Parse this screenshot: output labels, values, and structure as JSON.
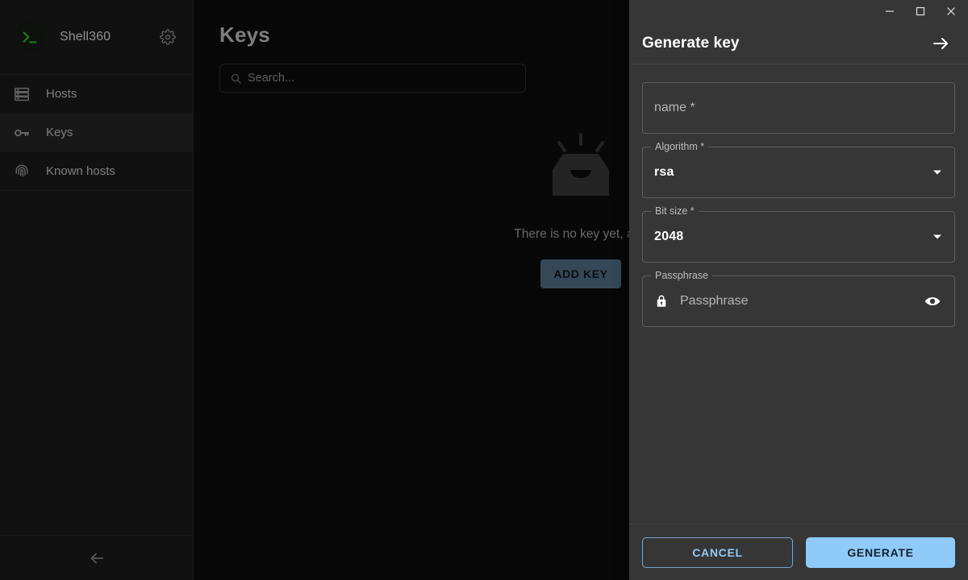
{
  "sidebar": {
    "brand": {
      "name": "Shell360",
      "logo_icon": "terminal-prompt-icon",
      "settings_icon": "gear-icon"
    },
    "items": [
      {
        "label": "Hosts",
        "icon": "server-icon",
        "selected": false
      },
      {
        "label": "Keys",
        "icon": "key-icon",
        "selected": true
      },
      {
        "label": "Known hosts",
        "icon": "fingerprint-icon",
        "selected": false
      }
    ],
    "collapse_icon": "arrow-left-icon"
  },
  "main": {
    "title": "Keys",
    "search": {
      "placeholder": "Search...",
      "value": "",
      "icon": "search-icon"
    },
    "empty": {
      "icon": "empty-inbox-icon",
      "message": "There is no key yet, add",
      "add_button": "ADD KEY"
    }
  },
  "window": {
    "minimize_icon": "minimize-icon",
    "maximize_icon": "maximize-icon",
    "close_icon": "close-icon"
  },
  "drawer": {
    "title": "Generate key",
    "close_icon": "arrow-right-icon",
    "fields": {
      "name": {
        "placeholder": "name *",
        "value": ""
      },
      "algorithm": {
        "legend": "Algorithm *",
        "value": "rsa",
        "caret_icon": "chevron-down-icon"
      },
      "bit_size": {
        "legend": "Bit size *",
        "value": "2048",
        "caret_icon": "chevron-down-icon"
      },
      "passphrase": {
        "legend": "Passphrase",
        "placeholder": "Passphrase",
        "value": "",
        "lock_icon": "lock-icon",
        "reveal_icon": "eye-icon"
      }
    },
    "actions": {
      "cancel": "CANCEL",
      "generate": "GENERATE"
    }
  },
  "colors": {
    "accent": "#90caf9",
    "brand_green": "#2eb82e",
    "sidebar_bg": "#1a1a1a",
    "main_bg": "#0c0c0c",
    "drawer_bg": "#363636",
    "add_key_bg": "#4d6a82"
  }
}
